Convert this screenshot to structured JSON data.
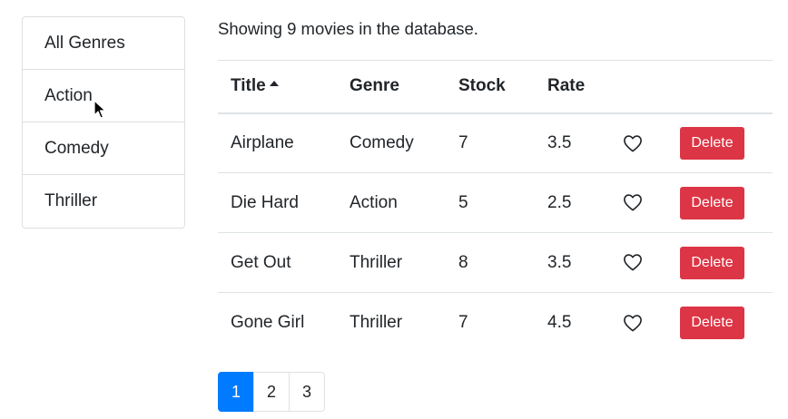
{
  "sidebar": {
    "genres": [
      {
        "label": "All Genres"
      },
      {
        "label": "Action"
      },
      {
        "label": "Comedy"
      },
      {
        "label": "Thriller"
      }
    ]
  },
  "main": {
    "summary": "Showing 9 movies in the database.",
    "table": {
      "headers": {
        "title": "Title",
        "genre": "Genre",
        "stock": "Stock",
        "rate": "Rate"
      },
      "sort": {
        "column": "title",
        "direction": "ascending",
        "icon": "sort-up-caret-icon"
      },
      "rows": [
        {
          "title": "Airplane",
          "genre": "Comedy",
          "stock": "7",
          "rate": "3.5",
          "liked": false,
          "delete_label": "Delete"
        },
        {
          "title": "Die Hard",
          "genre": "Action",
          "stock": "5",
          "rate": "2.5",
          "liked": false,
          "delete_label": "Delete"
        },
        {
          "title": "Get Out",
          "genre": "Thriller",
          "stock": "8",
          "rate": "3.5",
          "liked": false,
          "delete_label": "Delete"
        },
        {
          "title": "Gone Girl",
          "genre": "Thriller",
          "stock": "7",
          "rate": "4.5",
          "liked": false,
          "delete_label": "Delete"
        }
      ]
    },
    "pagination": {
      "pages": [
        "1",
        "2",
        "3"
      ],
      "current": "1"
    }
  },
  "icons": {
    "like": "heart-outline-icon",
    "cursor": "mouse-pointer-icon"
  },
  "colors": {
    "danger": "#dc3545",
    "primary": "#007bff",
    "border": "#dee2e6",
    "text": "#212529"
  }
}
